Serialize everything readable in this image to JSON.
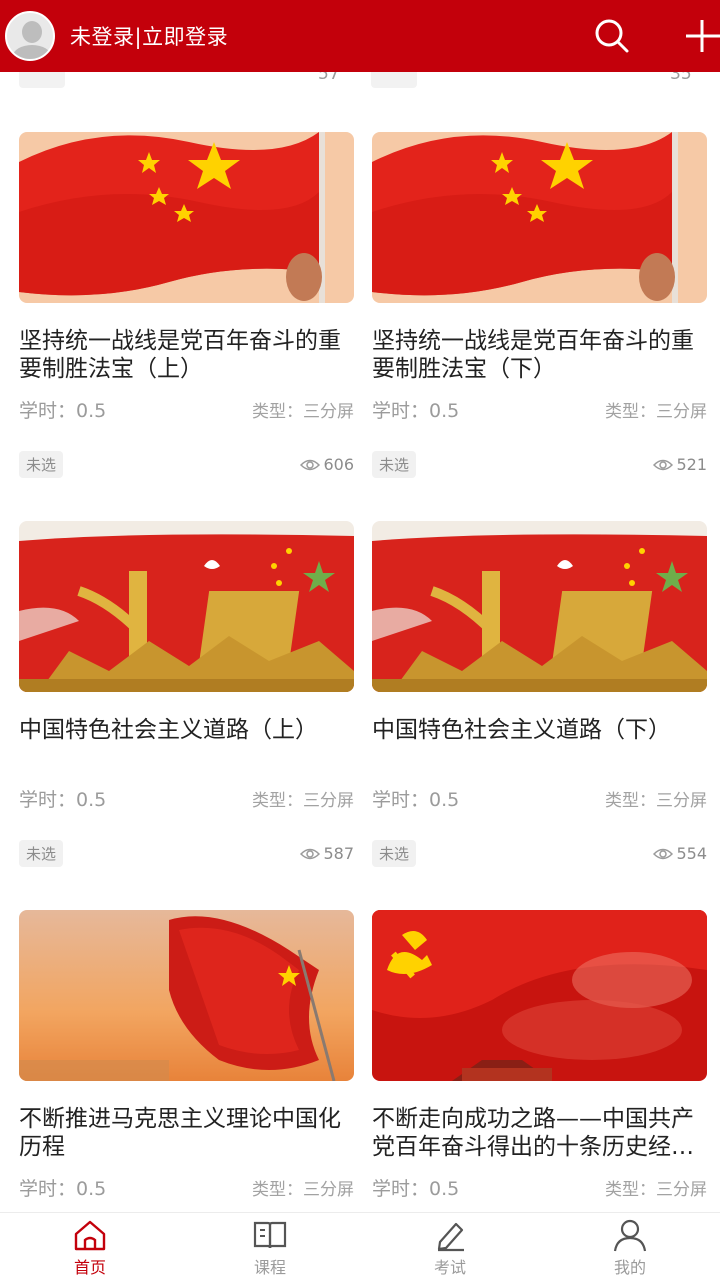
{
  "header": {
    "login_text": "未登录|立即登录",
    "search_icon": "search-icon",
    "add_icon": "plus-icon",
    "bg_color": "#c3000b"
  },
  "top_partial": {
    "left_views": "57",
    "right_views": "35"
  },
  "courses": [
    {
      "title": "坚持统一战线是党百年奋斗的重要制胜法宝（上）",
      "hours": "学时：0.5",
      "type": "类型：三分屏",
      "status": "未选",
      "views": "606",
      "image": "flag-hand"
    },
    {
      "title": "坚持统一战线是党百年奋斗的重要制胜法宝（下）",
      "hours": "学时：0.5",
      "type": "类型：三分屏",
      "status": "未选",
      "views": "521",
      "image": "flag-hand"
    },
    {
      "title": "中国特色社会主义道路（上）",
      "hours": "学时：0.5",
      "type": "类型：三分屏",
      "status": "未选",
      "views": "587",
      "image": "monument"
    },
    {
      "title": "中国特色社会主义道路（下）",
      "hours": "学时：0.5",
      "type": "类型：三分屏",
      "status": "未选",
      "views": "554",
      "image": "monument"
    },
    {
      "title": "不断推进马克思主义理论中国化历程",
      "hours": "学时：0.5",
      "type": "类型：三分屏",
      "status": "",
      "views": "",
      "image": "flag-sunset"
    },
    {
      "title": "不断走向成功之路——中国共产党百年奋斗得出的十条历史经…",
      "hours": "学时：0.5",
      "type": "类型：三分屏",
      "status": "",
      "views": "",
      "image": "party-flag"
    }
  ],
  "bottom_nav": [
    {
      "label": "首页",
      "icon": "home-icon",
      "active": true
    },
    {
      "label": "课程",
      "icon": "book-icon",
      "active": false
    },
    {
      "label": "考试",
      "icon": "pen-icon",
      "active": false
    },
    {
      "label": "我的",
      "icon": "user-icon",
      "active": false
    }
  ],
  "colors": {
    "accent": "#c3000b",
    "muted": "#9b9b9b"
  }
}
